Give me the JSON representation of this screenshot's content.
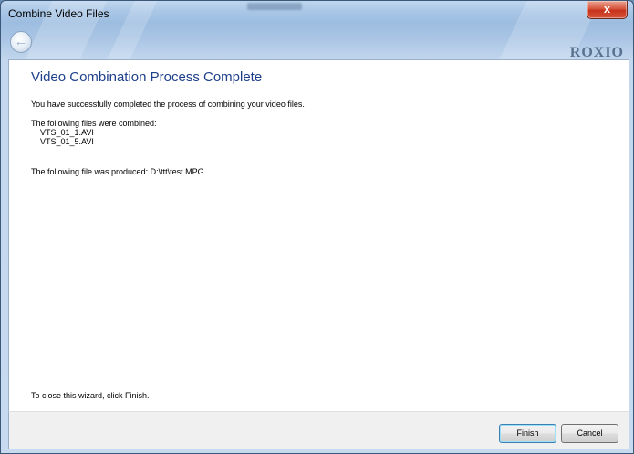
{
  "window": {
    "title": "Combine Video Files",
    "close_glyph": "x",
    "back_glyph": "←",
    "logo_text": "ROXIO"
  },
  "main": {
    "heading": "Video Combination Process Complete",
    "success_message": "You have successfully completed the process of combining your video files.",
    "combined_label": "The following files were combined:",
    "files": [
      "VTS_01_1.AVI",
      "VTS_01_5.AVI"
    ],
    "produced_label": "The following file was produced: D:\\ttt\\test.MPG",
    "close_hint": "To close this wizard, click Finish."
  },
  "footer": {
    "finish_label": "Finish",
    "cancel_label": "Cancel"
  },
  "colors": {
    "heading": "#1e3f8a",
    "close_button": "#c7321b",
    "frame": "#a9c6e6"
  }
}
